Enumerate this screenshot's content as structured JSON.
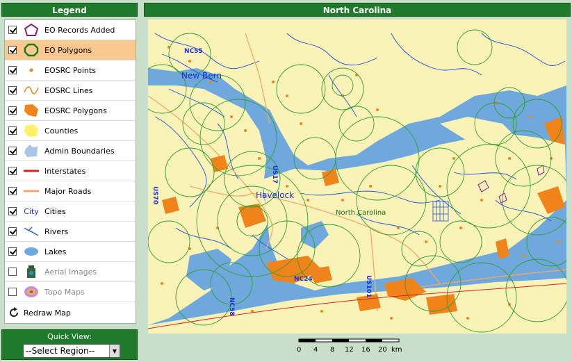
{
  "legend": {
    "title": "Legend",
    "items": [
      {
        "label": "EO Records Added",
        "checked": true,
        "selected": false,
        "symbol": "purple-pentagon-icon"
      },
      {
        "label": "EO Polygons",
        "checked": true,
        "selected": true,
        "symbol": "green-circle-icon"
      },
      {
        "label": "EOSRC Points",
        "checked": true,
        "selected": false,
        "symbol": "orange-dot-icon"
      },
      {
        "label": "EOSRC Lines",
        "checked": true,
        "selected": false,
        "symbol": "orange-line-icon"
      },
      {
        "label": "EOSRC Polygons",
        "checked": true,
        "selected": false,
        "symbol": "orange-polygon-icon"
      },
      {
        "label": "Counties",
        "checked": true,
        "selected": false,
        "symbol": "yellow-polygon-icon"
      },
      {
        "label": "Admin Boundaries",
        "checked": true,
        "selected": false,
        "symbol": "blue-polygon-icon"
      },
      {
        "label": "Interstates",
        "checked": true,
        "selected": false,
        "symbol": "red-line-icon"
      },
      {
        "label": "Major Roads",
        "checked": true,
        "selected": false,
        "symbol": "tan-line-icon"
      },
      {
        "label": "Cities",
        "checked": true,
        "selected": false,
        "symbol": "city-text-icon",
        "symbol_text": "City"
      },
      {
        "label": "Rivers",
        "checked": true,
        "selected": false,
        "symbol": "river-icon"
      },
      {
        "label": "Lakes",
        "checked": true,
        "selected": false,
        "symbol": "lake-icon"
      },
      {
        "label": "Aerial Images",
        "checked": false,
        "selected": false,
        "symbol": "aerial-image-icon"
      },
      {
        "label": "Topo Maps",
        "checked": false,
        "selected": false,
        "symbol": "topo-map-icon"
      }
    ],
    "redraw_label": "Redraw Map"
  },
  "quick_view": {
    "label": "Quick View:",
    "selected": "--Select Region--"
  },
  "map": {
    "title": "North Carolina",
    "labels": {
      "city1": "New Bern",
      "city2": "Havelock",
      "state": "North Carolina",
      "route1": "NC55",
      "route2": "NC24",
      "route3": "US17",
      "route4": "US70",
      "route5": "NC58",
      "route6": "US101"
    },
    "scale": {
      "ticks": [
        "0",
        "4",
        "8",
        "12",
        "16",
        "20"
      ],
      "unit": "km"
    },
    "colors": {
      "water": "#6fa8dc",
      "land": "#faf3b8",
      "eo_polygon": "#2e9e2e",
      "eosrc": "#f0841a",
      "river": "#1c4fd6",
      "eo_added": "#8b1a8b"
    }
  }
}
